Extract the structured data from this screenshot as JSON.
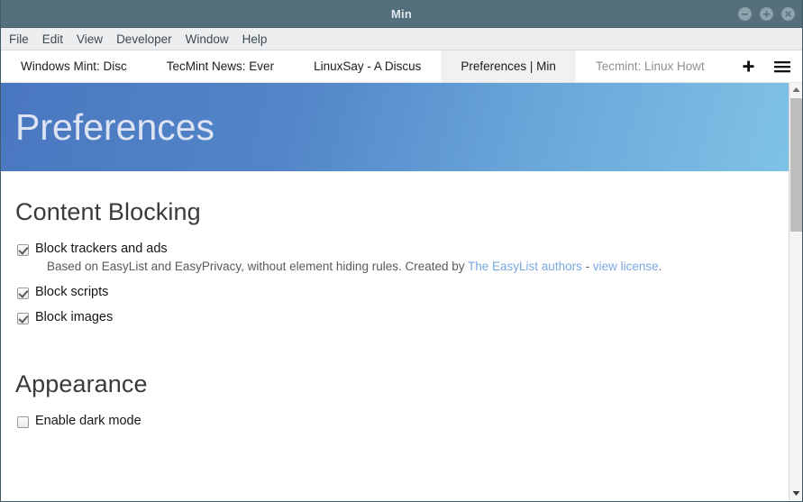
{
  "window": {
    "title": "Min",
    "controls": [
      {
        "name": "minimize-button",
        "glyph": "minus-circle-icon"
      },
      {
        "name": "maximize-button",
        "glyph": "plus-circle-icon"
      },
      {
        "name": "close-button",
        "glyph": "close-circle-icon"
      }
    ],
    "titlebar_bg": "#556f7c",
    "titlebar_fg": "#dfe8ee"
  },
  "menubar": {
    "items": [
      {
        "label": "File"
      },
      {
        "label": "Edit"
      },
      {
        "label": "View"
      },
      {
        "label": "Developer"
      },
      {
        "label": "Window"
      },
      {
        "label": "Help"
      }
    ]
  },
  "tabbar": {
    "tabs": [
      {
        "label": "Windows Mint: Disc",
        "active": false,
        "muted": false
      },
      {
        "label": "TecMint News: Ever",
        "active": false,
        "muted": false
      },
      {
        "label": "LinuxSay - A Discus",
        "active": false,
        "muted": false
      },
      {
        "label": "Preferences | Min",
        "active": true,
        "muted": false
      },
      {
        "label": "Tecmint: Linux Howt",
        "active": false,
        "muted": true
      }
    ],
    "new_tab_icon": "plus-icon",
    "menu_icon": "hamburger-menu-icon"
  },
  "hero": {
    "title": "Preferences",
    "gradient_from": "#4a77c0",
    "gradient_to": "#7fc2e6",
    "title_color": "#dde3f2"
  },
  "sections": [
    {
      "name": "content-blocking",
      "title": "Content Blocking",
      "options": [
        {
          "name": "block-trackers-and-ads",
          "label": "Block trackers and ads",
          "checked": true,
          "description": {
            "prefix": "Based on EasyList and EasyPrivacy, without element hiding rules. Created by ",
            "link1": "The EasyList authors",
            "separator": " - ",
            "link2": "view license",
            "suffix": "."
          }
        },
        {
          "name": "block-scripts",
          "label": "Block scripts",
          "checked": true
        },
        {
          "name": "block-images",
          "label": "Block images",
          "checked": true
        }
      ]
    },
    {
      "name": "appearance",
      "title": "Appearance",
      "options": [
        {
          "name": "enable-dark-mode",
          "label": "Enable dark mode",
          "checked": false
        }
      ]
    }
  ],
  "scrollbar": {
    "up_icon": "caret-up-icon",
    "down_icon": "caret-down-icon",
    "thumb_position": "top"
  },
  "colors": {
    "link": "#7aa8e0",
    "active_tab_bg": "#f1f1f1",
    "menubar_bg": "#edeeef"
  }
}
